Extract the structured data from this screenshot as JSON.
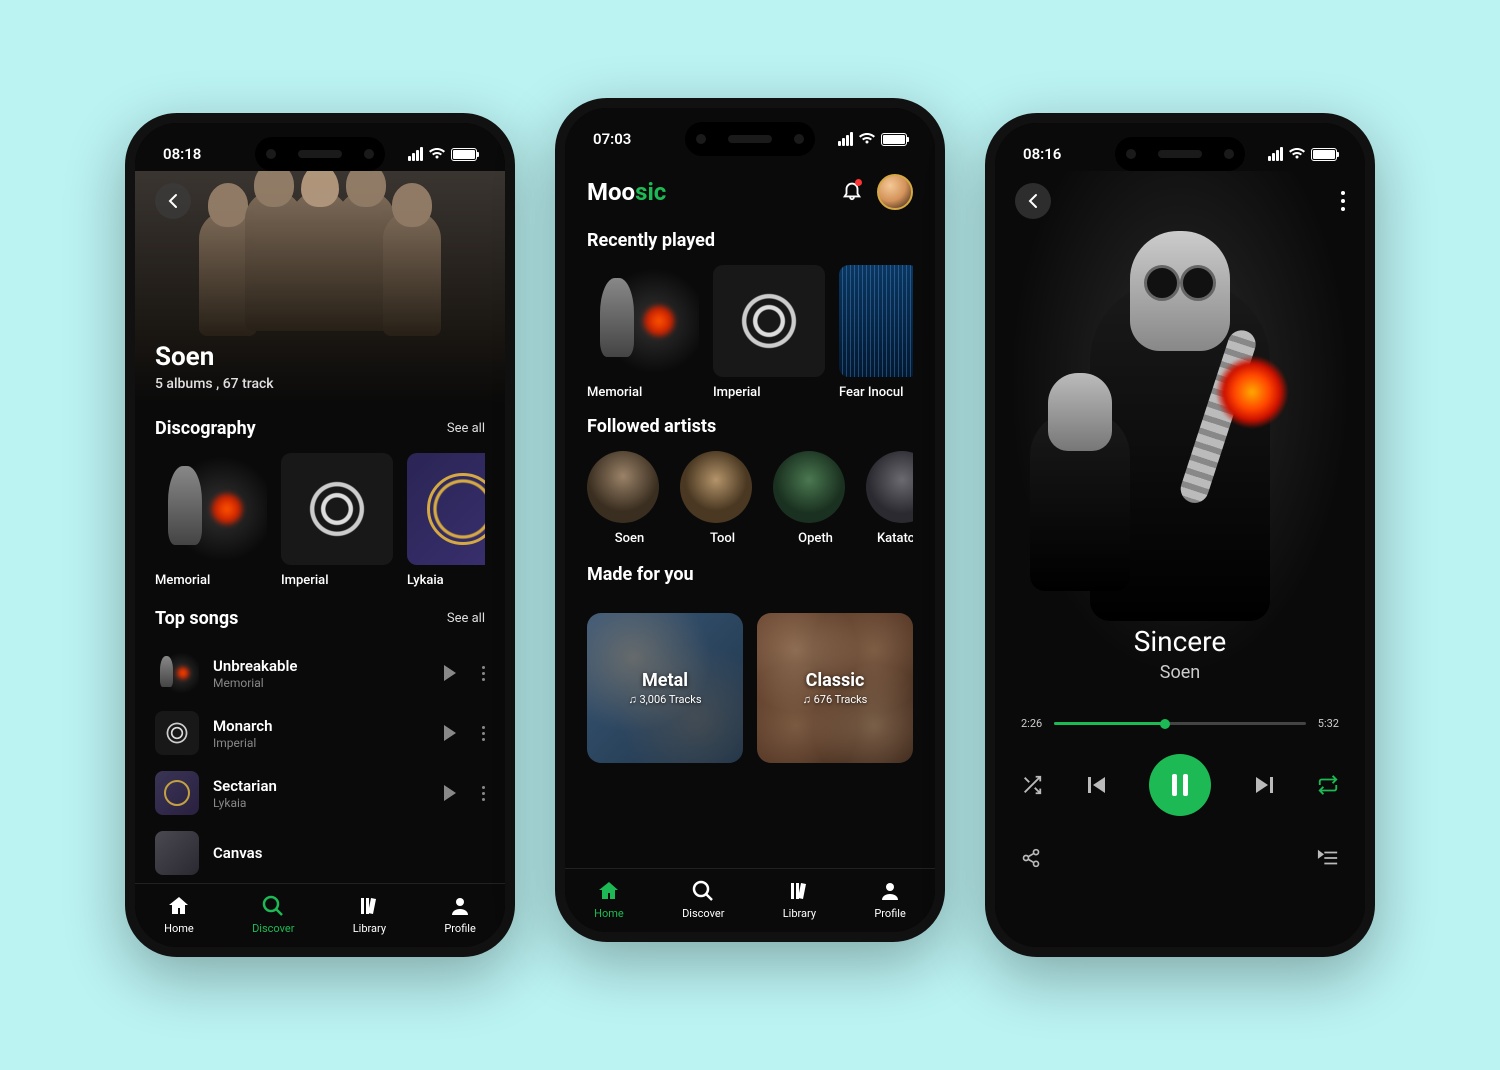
{
  "colors": {
    "accent": "#1db954",
    "bg": "#0a0a0a"
  },
  "screen1": {
    "status_time": "08:18",
    "artist_name": "Soen",
    "artist_meta": "5 albums , 67 track",
    "discography": {
      "title": "Discography",
      "see_all": "See all",
      "albums": [
        {
          "title": "Memorial"
        },
        {
          "title": "Imperial"
        },
        {
          "title": "Lykaia"
        }
      ]
    },
    "top_songs": {
      "title": "Top songs",
      "see_all": "See all",
      "songs": [
        {
          "title": "Unbreakable",
          "album": "Memorial"
        },
        {
          "title": "Monarch",
          "album": "Imperial"
        },
        {
          "title": "Sectarian",
          "album": "Lykaia"
        },
        {
          "title": "Canvas",
          "album": ""
        }
      ]
    },
    "tabs": [
      {
        "label": "Home"
      },
      {
        "label": "Discover"
      },
      {
        "label": "Library"
      },
      {
        "label": "Profile"
      }
    ]
  },
  "screen2": {
    "status_time": "07:03",
    "logo_a": "Moo",
    "logo_b": "sic",
    "recently": {
      "title": "Recently played",
      "items": [
        {
          "title": "Memorial"
        },
        {
          "title": "Imperial"
        },
        {
          "title": "Fear Inocul"
        }
      ]
    },
    "followed": {
      "title": "Followed artists",
      "items": [
        {
          "name": "Soen"
        },
        {
          "name": "Tool"
        },
        {
          "name": "Opeth"
        },
        {
          "name": "Katato"
        }
      ]
    },
    "made_for_you": {
      "title": "Made for you",
      "items": [
        {
          "title": "Metal",
          "tracks": "♫ 3,006 Tracks"
        },
        {
          "title": "Classic",
          "tracks": "♫ 676 Tracks"
        }
      ]
    },
    "tabs": [
      {
        "label": "Home"
      },
      {
        "label": "Discover"
      },
      {
        "label": "Library"
      },
      {
        "label": "Profile"
      }
    ]
  },
  "screen3": {
    "status_time": "08:16",
    "track_title": "Sincere",
    "track_artist": "Soen",
    "elapsed": "2:26",
    "total": "5:32"
  }
}
